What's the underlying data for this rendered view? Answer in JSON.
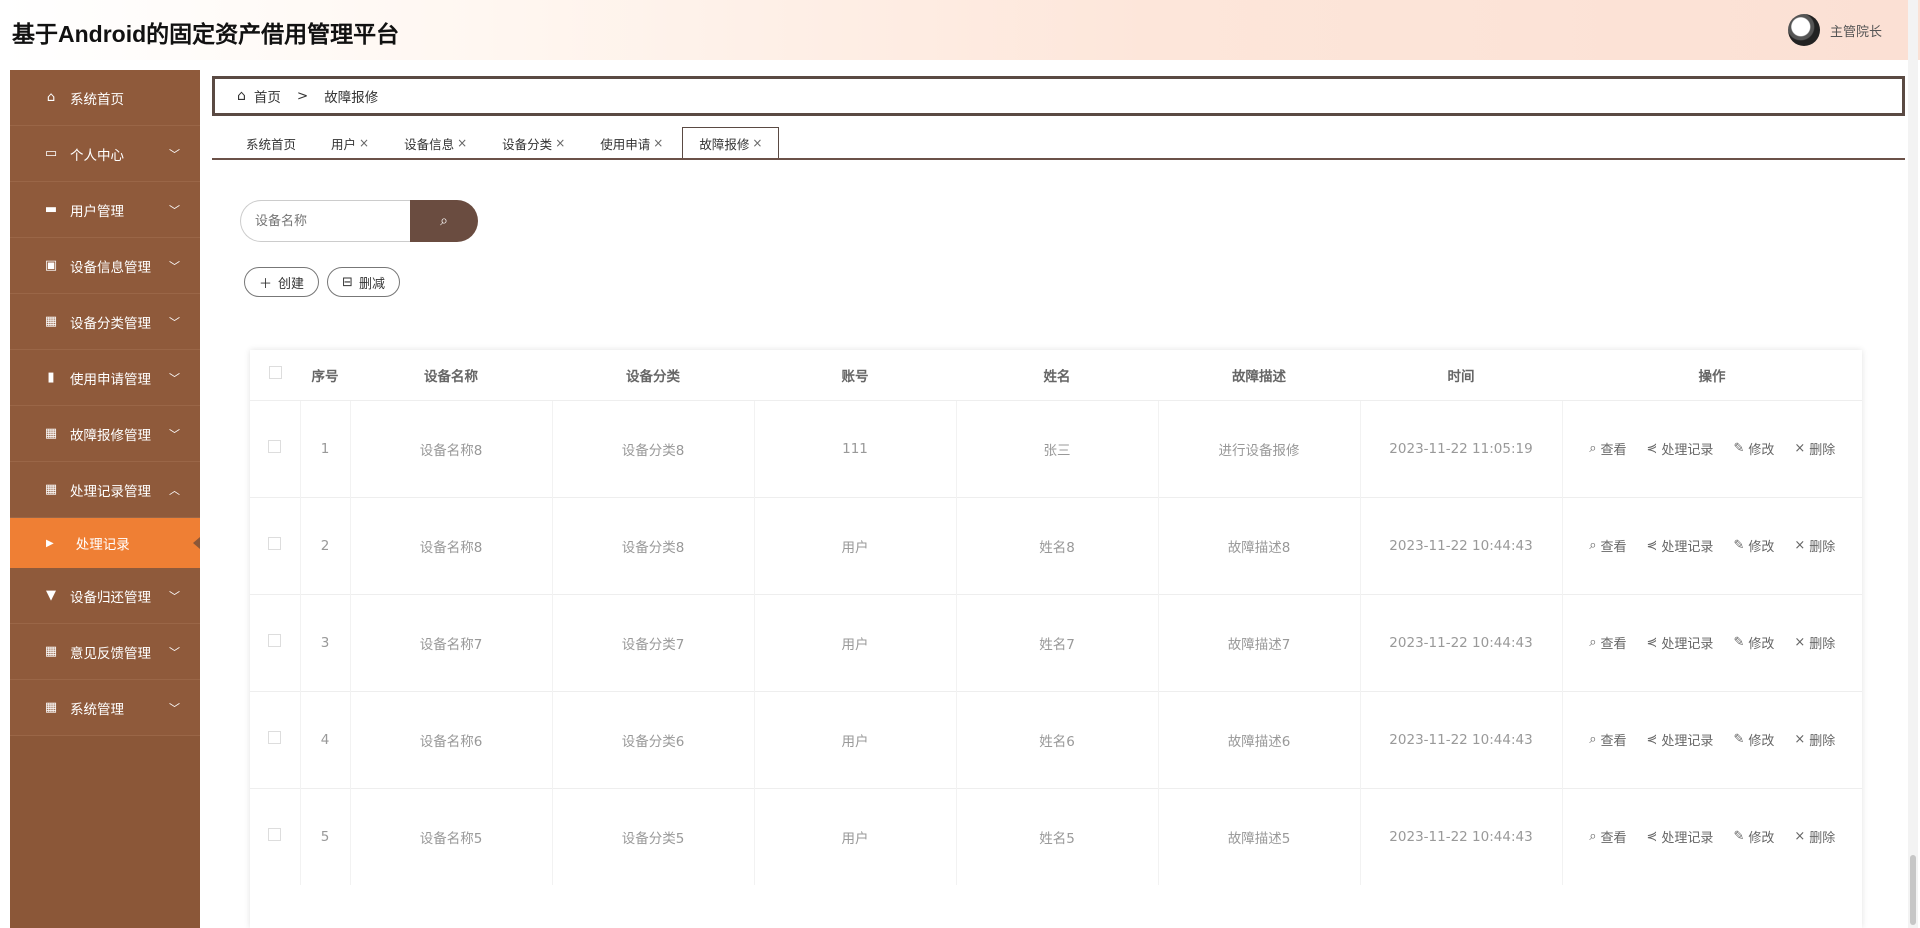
{
  "header": {
    "title": "基于Android的固定资产借用管理平台",
    "user_name": "主管院长"
  },
  "sidebar": {
    "items": [
      {
        "label": "系统首页",
        "icon": "home-icon",
        "expandable": false
      },
      {
        "label": "个人中心",
        "icon": "card-icon",
        "expandable": true
      },
      {
        "label": "用户管理",
        "icon": "monitor-icon",
        "expandable": true
      },
      {
        "label": "设备信息管理",
        "icon": "clipboard-icon",
        "expandable": true
      },
      {
        "label": "设备分类管理",
        "icon": "grid-icon",
        "expandable": true
      },
      {
        "label": "使用申请管理",
        "icon": "bar-chart-icon",
        "expandable": true
      },
      {
        "label": "故障报修管理",
        "icon": "grid-icon",
        "expandable": true
      },
      {
        "label": "处理记录管理",
        "icon": "grid-icon",
        "expandable": true,
        "expanded": true
      },
      {
        "label": "设备归还管理",
        "icon": "stamp-icon",
        "expandable": true
      },
      {
        "label": "意见反馈管理",
        "icon": "grid-icon",
        "expandable": true
      },
      {
        "label": "系统管理",
        "icon": "grid-icon",
        "expandable": true
      }
    ],
    "sub_item": {
      "label": "处理记录"
    }
  },
  "breadcrumb": {
    "home": "首页",
    "separator": ">",
    "current": "故障报修"
  },
  "tabs": [
    {
      "label": "系统首页",
      "closable": false
    },
    {
      "label": "用户",
      "closable": true
    },
    {
      "label": "设备信息",
      "closable": true
    },
    {
      "label": "设备分类",
      "closable": true
    },
    {
      "label": "使用申请",
      "closable": true
    },
    {
      "label": "故障报修",
      "closable": true,
      "active": true
    }
  ],
  "search": {
    "placeholder": "设备名称"
  },
  "actions": {
    "create": "创建",
    "delete": "删减"
  },
  "table": {
    "headers": [
      "序号",
      "设备名称",
      "设备分类",
      "账号",
      "姓名",
      "故障描述",
      "时间",
      "操作"
    ],
    "rows": [
      {
        "no": "1",
        "device": "设备名称8",
        "category": "设备分类8",
        "account": "111",
        "name": "张三",
        "desc": "进行设备报修",
        "time": "2023-11-22 11:05:19"
      },
      {
        "no": "2",
        "device": "设备名称8",
        "category": "设备分类8",
        "account": "用户",
        "name": "姓名8",
        "desc": "故障描述8",
        "time": "2023-11-22 10:44:43"
      },
      {
        "no": "3",
        "device": "设备名称7",
        "category": "设备分类7",
        "account": "用户",
        "name": "姓名7",
        "desc": "故障描述7",
        "time": "2023-11-22 10:44:43"
      },
      {
        "no": "4",
        "device": "设备名称6",
        "category": "设备分类6",
        "account": "用户",
        "name": "姓名6",
        "desc": "故障描述6",
        "time": "2023-11-22 10:44:43"
      },
      {
        "no": "5",
        "device": "设备名称5",
        "category": "设备分类5",
        "account": "用户",
        "name": "姓名5",
        "desc": "故障描述5",
        "time": "2023-11-22 10:44:43"
      }
    ],
    "row_actions": {
      "view": "查看",
      "process": "处理记录",
      "edit": "修改",
      "delete": "删除"
    }
  }
}
